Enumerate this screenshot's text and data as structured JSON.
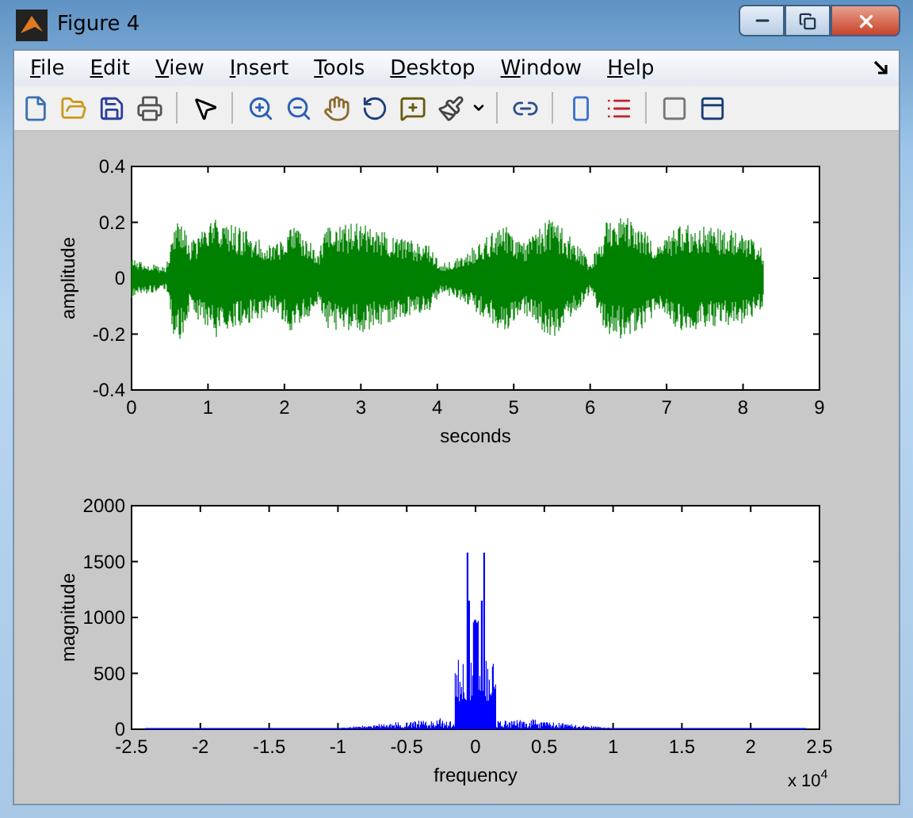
{
  "window": {
    "title": "Figure 4"
  },
  "menu": [
    "File",
    "Edit",
    "View",
    "Insert",
    "Tools",
    "Desktop",
    "Window",
    "Help"
  ],
  "plots": [
    {
      "kind": "waveform",
      "color": "#008000",
      "xticks": [
        "0",
        "1",
        "2",
        "3",
        "4",
        "5",
        "6",
        "7",
        "8",
        "9"
      ],
      "yticks": [
        "0.4",
        "0.2",
        "0",
        "-0.2",
        "-0.4"
      ],
      "xlabel": "seconds",
      "ylabel": "amplitude"
    },
    {
      "kind": "spectrum",
      "color": "#0000ff",
      "xticks": [
        "-2.5",
        "-2",
        "-1.5",
        "-1",
        "-0.5",
        "0",
        "0.5",
        "1",
        "1.5",
        "2",
        "2.5"
      ],
      "yticks": [
        "2000",
        "1500",
        "1000",
        "500",
        "0"
      ],
      "xlabel": "frequency",
      "ylabel": "magnitude",
      "exponent": {
        "base": "x 10",
        "power": "4"
      }
    }
  ]
}
